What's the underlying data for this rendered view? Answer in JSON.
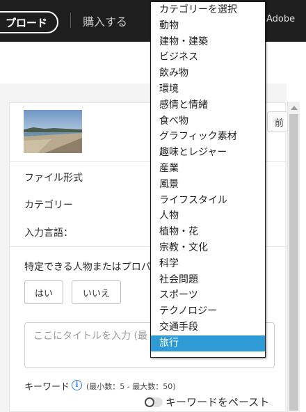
{
  "topbar": {
    "upload_label": "プロード",
    "buy_label": "購入する",
    "brand_text": "Adobe"
  },
  "panel": {
    "file_format_label": "ファイル形式",
    "category_label": "カテゴリー",
    "input_language_label": "入力言語：",
    "person_question": "特定できる人物またはプロパ",
    "yes_label": "はい",
    "no_label": "いいえ",
    "title_placeholder": "ここにタイトルを入力 (最",
    "keyword_label": "キーワード",
    "keyword_range": "(最小数：5 - 最大数：50)",
    "paste_keywords_label": "キーワードをペースト",
    "right_button_fragment": "前"
  },
  "dropdown": {
    "items": [
      "カテゴリーを選択",
      "動物",
      "建物・建築",
      "ビジネス",
      "飲み物",
      "環境",
      "感情と情緒",
      "食べ物",
      "グラフィック素材",
      "趣味とレジャー",
      "産業",
      "風景",
      "ライフスタイル",
      "人物",
      "植物・花",
      "宗教・文化",
      "科学",
      "社会問題",
      "スポーツ",
      "テクノロジー",
      "交通手段",
      "旅行"
    ],
    "selected": "旅行",
    "highlight_color": "#2f9bd6"
  },
  "icons": {
    "info": "info-icon",
    "scroll_up": "chevron-up-icon"
  },
  "thumbnail": {
    "description_visible": false
  }
}
